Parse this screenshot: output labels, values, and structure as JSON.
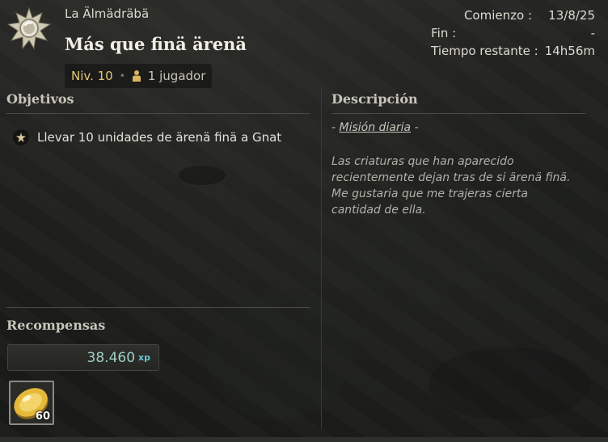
{
  "header": {
    "zone": "La Älmädräbä",
    "title": "Más que finä ärenä",
    "level": "Niv. 10",
    "players": "1 jugador",
    "quest_icon": "sun-badge-icon"
  },
  "dates": {
    "start_label": "Comienzo :",
    "start_value": "13/8/25",
    "end_label": "Fin :",
    "end_value": "-",
    "remaining_label": "Tiempo restante :",
    "remaining_value": "14h56m"
  },
  "objectives": {
    "title": "Objetivos",
    "items": [
      {
        "text": "Llevar 10 unidades de ärenä finä a Gnat",
        "icon": "star-bullet-icon"
      }
    ]
  },
  "description": {
    "title": "Descripción",
    "prefix": "- ",
    "type": "Misión diaria",
    "suffix": " -",
    "text": "Las criaturas que han aparecido recientemente dejan tras de si ärenä finä. Me gustaria que me trajeras cierta cantidad de ella."
  },
  "rewards": {
    "title": "Recompensas",
    "xp_value": "38.460",
    "xp_unit": "xp",
    "items": [
      {
        "icon": "gold-coin-icon",
        "quantity": "60"
      }
    ]
  },
  "colors": {
    "level": "#e3c774",
    "xp": "#9ecfc8",
    "xp_unit": "#67c8d8"
  }
}
